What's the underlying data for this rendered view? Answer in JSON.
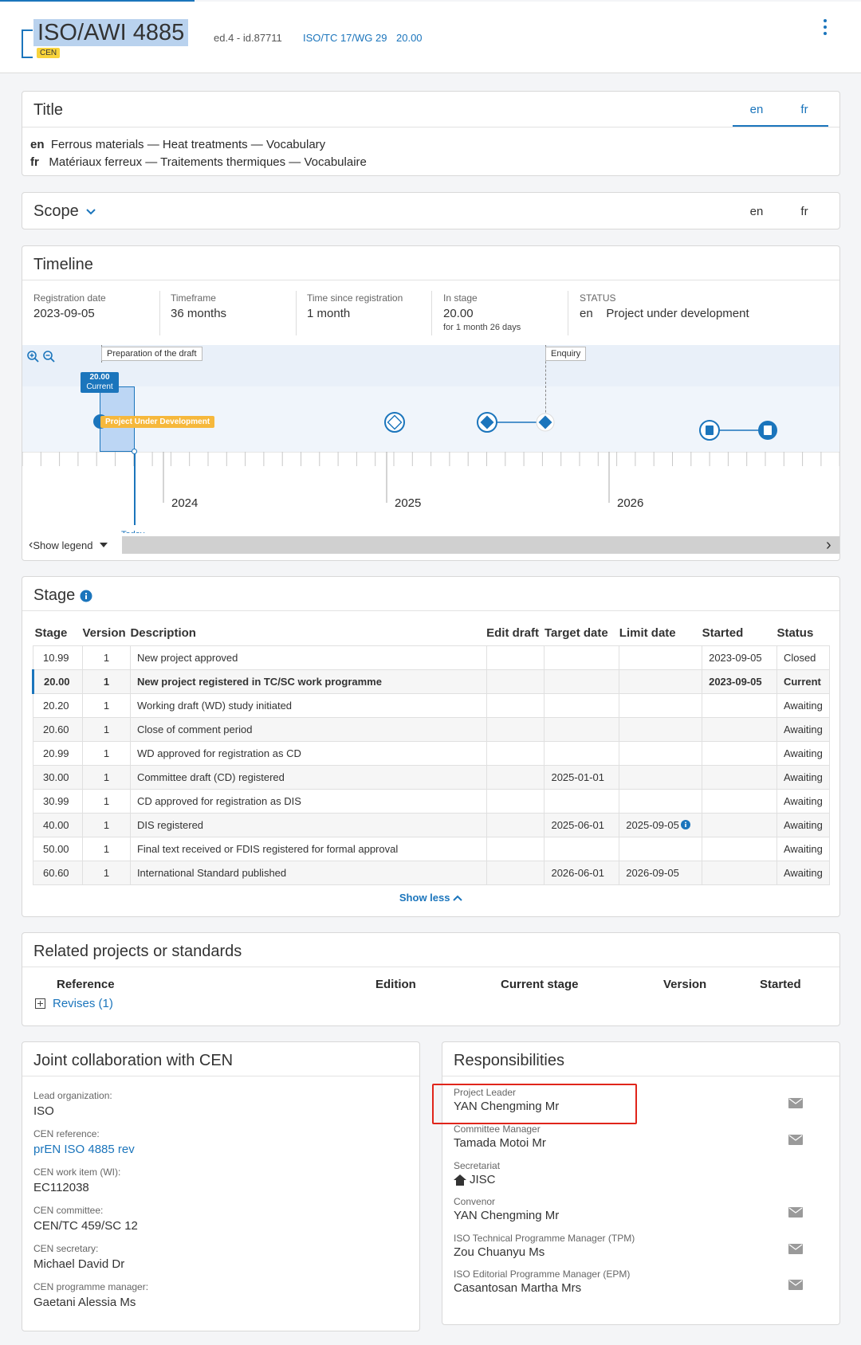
{
  "header": {
    "reference": "ISO/AWI 4885",
    "badge": "CEN",
    "edition": "ed.4 - id.87711",
    "committee": "ISO/TC 17/WG 29",
    "stage_code": "20.00"
  },
  "title_card": {
    "heading": "Title",
    "tabs": [
      "en",
      "fr"
    ],
    "rows": [
      {
        "lang": "en",
        "text": "Ferrous materials — Heat treatments — Vocabulary"
      },
      {
        "lang": "fr",
        "text": "Matériaux ferreux — Traitements thermiques — Vocabulaire"
      }
    ]
  },
  "scope_card": {
    "heading": "Scope",
    "tabs": [
      "en",
      "fr"
    ]
  },
  "timeline": {
    "heading": "Timeline",
    "registration_label": "Registration date",
    "registration_value": "2023-09-05",
    "timeframe_label": "Timeframe",
    "timeframe_value": "36 months",
    "since_label": "Time since registration",
    "since_value": "1 month",
    "instage_label": "In stage",
    "instage_value": "20.00",
    "instage_sub": "for 1 month 26 days",
    "status_label": "STATUS",
    "status_lang": "en",
    "status_value": "Project under development",
    "phase_prep": "Preparation of the draft",
    "phase_enquiry": "Enquiry",
    "current_code": "20.00",
    "current_label": "Current",
    "dev_badge": "Project Under Development",
    "years": [
      "2024",
      "2025",
      "2026"
    ],
    "today_label": "Today",
    "legend_toggle": "Show legend"
  },
  "stage_card": {
    "heading": "Stage",
    "columns": [
      "Stage",
      "Version",
      "Description",
      "Edit draft",
      "Target date",
      "Limit date",
      "Started",
      "Status"
    ],
    "rows": [
      {
        "stage": "10.99",
        "version": "1",
        "desc": "New project approved",
        "edit": "",
        "target": "",
        "limit": "",
        "started": "2023-09-05",
        "status": "Closed"
      },
      {
        "stage": "20.00",
        "version": "1",
        "desc": "New project registered in TC/SC work programme",
        "edit": "",
        "target": "",
        "limit": "",
        "started": "2023-09-05",
        "status": "Current"
      },
      {
        "stage": "20.20",
        "version": "1",
        "desc": "Working draft (WD) study initiated",
        "edit": "",
        "target": "",
        "limit": "",
        "started": "",
        "status": "Awaiting"
      },
      {
        "stage": "20.60",
        "version": "1",
        "desc": "Close of comment period",
        "edit": "",
        "target": "",
        "limit": "",
        "started": "",
        "status": "Awaiting"
      },
      {
        "stage": "20.99",
        "version": "1",
        "desc": "WD approved for registration as CD",
        "edit": "",
        "target": "",
        "limit": "",
        "started": "",
        "status": "Awaiting"
      },
      {
        "stage": "30.00",
        "version": "1",
        "desc": "Committee draft (CD) registered",
        "edit": "",
        "target": "2025-01-01",
        "limit": "",
        "started": "",
        "status": "Awaiting"
      },
      {
        "stage": "30.99",
        "version": "1",
        "desc": "CD approved for registration as DIS",
        "edit": "",
        "target": "",
        "limit": "",
        "started": "",
        "status": "Awaiting"
      },
      {
        "stage": "40.00",
        "version": "1",
        "desc": "DIS registered",
        "edit": "",
        "target": "2025-06-01",
        "limit": "2025-09-05",
        "started": "",
        "status": "Awaiting"
      },
      {
        "stage": "50.00",
        "version": "1",
        "desc": "Final text received or FDIS registered for formal approval",
        "edit": "",
        "target": "",
        "limit": "",
        "started": "",
        "status": "Awaiting"
      },
      {
        "stage": "60.60",
        "version": "1",
        "desc": "International Standard published",
        "edit": "",
        "target": "2026-06-01",
        "limit": "2026-09-05",
        "started": "",
        "status": "Awaiting"
      }
    ],
    "show_less": "Show less"
  },
  "related": {
    "heading": "Related projects or standards",
    "columns": [
      "Reference",
      "Edition",
      "Current stage",
      "Version",
      "Started"
    ],
    "revises": "Revises (1)"
  },
  "joint": {
    "heading": "Joint collaboration with CEN",
    "lead_label": "Lead organization:",
    "lead_value": "ISO",
    "ref_label": "CEN reference:",
    "ref_value": "prEN ISO 4885 rev",
    "wi_label": "CEN work item (WI):",
    "wi_value": "EC112038",
    "committee_label": "CEN committee:",
    "committee_value": "CEN/TC 459/SC 12",
    "secretary_label": "CEN secretary:",
    "secretary_value": "Michael David Dr",
    "pm_label": "CEN programme manager:",
    "pm_value": "Gaetani Alessia Ms"
  },
  "resp": {
    "heading": "Responsibilities",
    "items": [
      {
        "role": "Project Leader",
        "name": "YAN Chengming Mr"
      },
      {
        "role": "Committee Manager",
        "name": "Tamada Motoi Mr"
      },
      {
        "role": "Secretariat",
        "name": "JISC"
      },
      {
        "role": "Convenor",
        "name": "YAN Chengming Mr"
      },
      {
        "role": "ISO Technical Programme Manager (TPM)",
        "name": "Zou Chuanyu Ms"
      },
      {
        "role": "ISO Editorial Programme Manager (EPM)",
        "name": "Casantosan Martha Mrs"
      }
    ]
  },
  "colors": {
    "accent": "#1b75bc",
    "badge": "#f8d33b",
    "highlight": "#e0251b"
  }
}
